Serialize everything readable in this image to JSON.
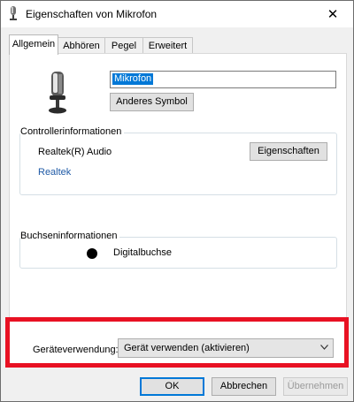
{
  "window": {
    "title": "Eigenschaften von Mikrofon",
    "close_glyph": "✕"
  },
  "tabs": [
    {
      "label": "Allgemein",
      "active": true
    },
    {
      "label": "Abhören",
      "active": false
    },
    {
      "label": "Pegel",
      "active": false
    },
    {
      "label": "Erweitert",
      "active": false
    }
  ],
  "general": {
    "device_name": "Mikrofon",
    "change_icon_label": "Anderes Symbol"
  },
  "controller": {
    "group_label": "Controllerinformationen",
    "name": "Realtek(R) Audio",
    "properties_label": "Eigenschaften",
    "vendor_link": "Realtek"
  },
  "jack": {
    "group_label": "Buchseninformationen",
    "name": "Digitalbuchse"
  },
  "usage": {
    "label": "Geräteverwendung:",
    "selected": "Gerät verwenden (aktivieren)"
  },
  "buttons": {
    "ok": "OK",
    "cancel": "Abbrechen",
    "apply": "Übernehmen"
  },
  "colors": {
    "highlight": "#e81123",
    "selection": "#0078d7",
    "link": "#1f5aa6"
  }
}
